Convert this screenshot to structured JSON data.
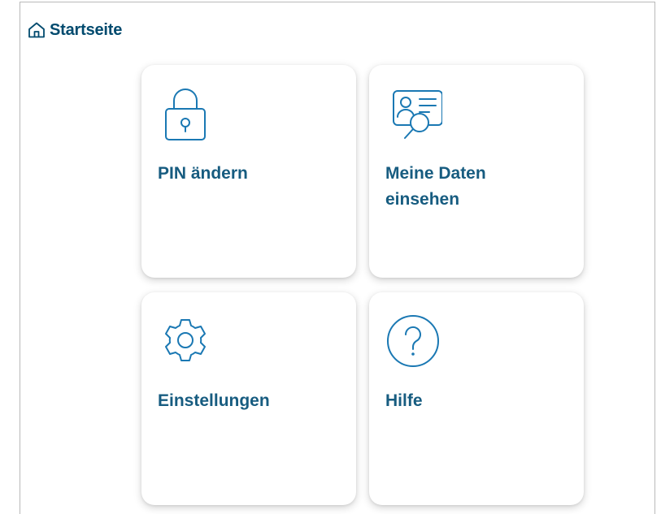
{
  "header": {
    "title": "Startseite",
    "icon": "home-icon"
  },
  "tiles": [
    {
      "label": "PIN ändern",
      "icon": "lock-icon"
    },
    {
      "label": "Meine Daten einsehen",
      "icon": "id-card-search-icon"
    },
    {
      "label": "Einstellungen",
      "icon": "gear-icon"
    },
    {
      "label": "Hilfe",
      "icon": "question-circle-icon"
    }
  ],
  "colors": {
    "title": "#004a6e",
    "tile_label": "#175c80",
    "icon_stroke": "#1a78b3",
    "border": "#b9b9b9"
  }
}
